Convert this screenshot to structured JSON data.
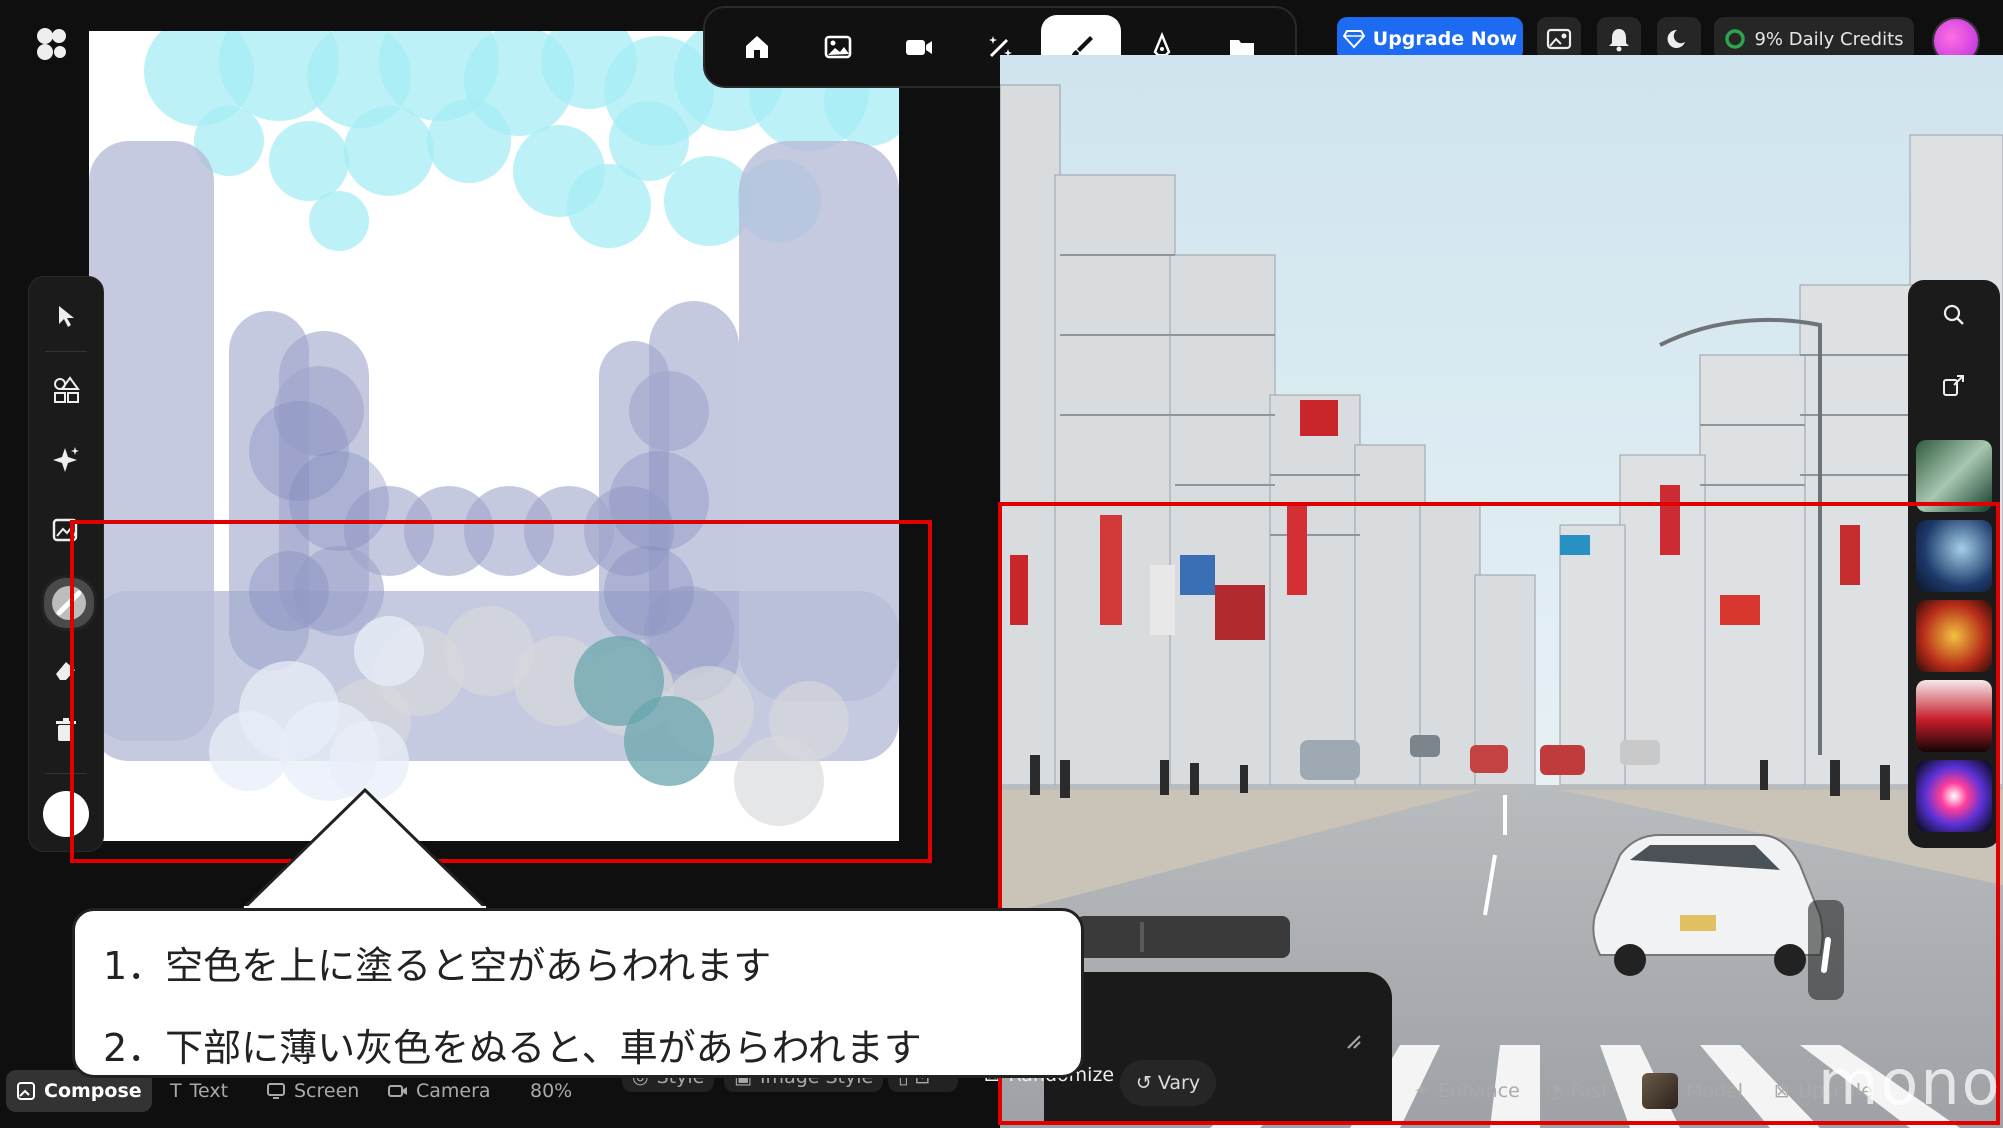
{
  "header": {
    "upgrade_label": "Upgrade Now",
    "credits_label": "9% Daily Credits"
  },
  "toolbar": {
    "items": [
      "home-icon",
      "image-icon",
      "video-icon",
      "magic-wand-icon",
      "brush-icon",
      "pen-nib-icon",
      "folder-icon"
    ],
    "active": "brush-icon"
  },
  "palette": {
    "tools": [
      "cursor-icon",
      "shapes-icon",
      "sparkle-icon",
      "image-plus-icon",
      "brush-size-icon",
      "eraser-icon",
      "trash-icon",
      "color-swatch"
    ]
  },
  "callout": {
    "line1": "1．空色を上に塗ると空があらわれます",
    "line2": "2．下部に薄い灰色をぬると、車があらわれます"
  },
  "bottombar": {
    "compose": "Compose",
    "text": "Text",
    "screen": "Screen",
    "camera": "Camera",
    "zoom": "80%",
    "style": "Style",
    "image_style": "Image Style",
    "randomize": "Randomize",
    "vary": "Vary",
    "enhance": "Enhance",
    "fast": "Fast",
    "model": "Model",
    "upscale": "Upscale"
  },
  "watermark": "mono",
  "colors": {
    "accent_blue": "#1d6bf0",
    "highlight_red": "#e00000",
    "sky_paint": "#a6ecf5",
    "lavender_paint": "#b7bdd8",
    "gray_paint": "#d7d9dc"
  }
}
